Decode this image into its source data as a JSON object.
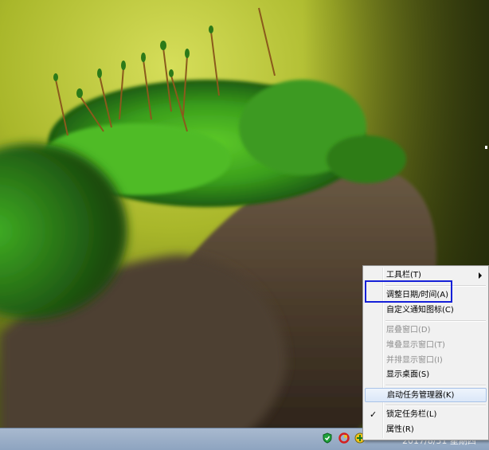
{
  "context_menu": {
    "items": [
      {
        "label": "工具栏(T)",
        "has_submenu": true,
        "disabled": false
      },
      {
        "label": "调整日期/时间(A)",
        "disabled": false
      },
      {
        "label": "自定义通知图标(C)",
        "disabled": false
      },
      {
        "label": "层叠窗口(D)",
        "disabled": true
      },
      {
        "label": "堆叠显示窗口(T)",
        "disabled": true
      },
      {
        "label": "并排显示窗口(I)",
        "disabled": true
      },
      {
        "label": "显示桌面(S)",
        "disabled": false
      },
      {
        "label": "启动任务管理器(K)",
        "disabled": false,
        "hovered": true
      },
      {
        "label": "锁定任务栏(L)",
        "checked": true,
        "disabled": false
      },
      {
        "label": "属性(R)",
        "disabled": false
      }
    ],
    "check_glyph": "✓"
  },
  "taskbar": {
    "clock": "2017/8/31 星期四",
    "tray_icons": [
      "shield-icon",
      "browser-icon",
      "security-plus-icon"
    ]
  },
  "colors": {
    "highlight_box": "#1520d8",
    "menu_bg": "#f1f1f1",
    "taskbar": "#9aaec8"
  }
}
